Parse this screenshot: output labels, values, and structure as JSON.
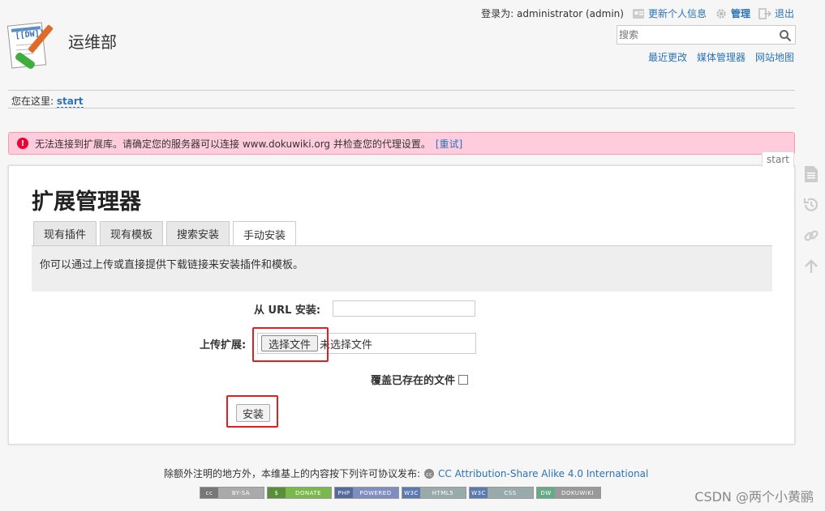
{
  "header": {
    "site_title": "运维部",
    "logged_in": "登录为: administrator (admin)",
    "update_profile": "更新个人信息",
    "admin": "管理",
    "logout": "退出",
    "search_placeholder": "搜索",
    "site_tools": [
      "最近更改",
      "媒体管理器",
      "网站地图"
    ]
  },
  "breadcrumb": {
    "label": "您在这里:",
    "current": "start"
  },
  "alert": {
    "message": "无法连接到扩展库。请确定您的服务器可以连接 www.dokuwiki.org 并检查您的代理设置。",
    "retry": "[重试]"
  },
  "page": {
    "tag": "start",
    "title": "扩展管理器",
    "tabs": [
      "现有插件",
      "现有模板",
      "搜索安装",
      "手动安装"
    ],
    "tab_desc": "你可以通过上传或直接提供下载链接来安装插件和模板。"
  },
  "form": {
    "url_label": "从 URL 安装:",
    "upload_label": "上传扩展:",
    "choose_file": "选择文件",
    "no_file": "未选择文件",
    "overwrite_label": "覆盖已存在的文件",
    "install": "安装"
  },
  "footer": {
    "license_text": "除额外注明的地方外，本维基上的内容按下列许可协议发布:",
    "license_link": "CC Attribution-Share Alike 4.0 International",
    "badges": [
      {
        "left": "cc",
        "right": "BY-SA"
      },
      {
        "left": "$",
        "right": "DONATE"
      },
      {
        "left": "PHP",
        "right": "POWERED"
      },
      {
        "left": "W3C",
        "right": "HTML5"
      },
      {
        "left": "W3C",
        "right": "CSS"
      },
      {
        "left": "DW",
        "right": "DOKUWIKI"
      }
    ],
    "watermark": "CSDN @两个小黄鹂"
  },
  "colors": {
    "link": "#2b73b7",
    "alert_bg": "#ffccdd",
    "highlight": "#e02020"
  }
}
